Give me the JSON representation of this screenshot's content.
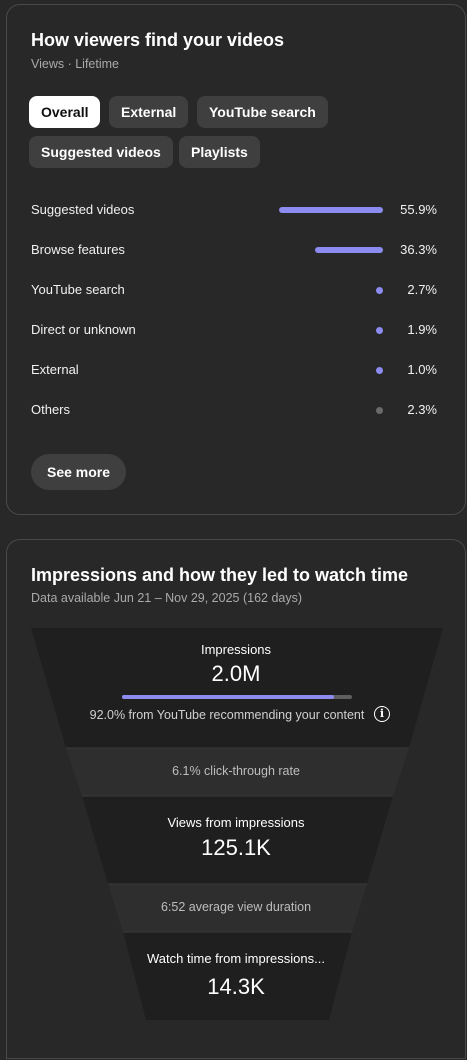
{
  "traffic_sources": {
    "title": "How viewers find your videos",
    "subtitle": "Views · Lifetime",
    "chips": [
      {
        "label": "Overall",
        "active": true
      },
      {
        "label": "External",
        "active": false
      },
      {
        "label": "YouTube search",
        "active": false
      },
      {
        "label": "Suggested videos",
        "active": false
      },
      {
        "label": "Playlists",
        "active": false
      }
    ],
    "rows": [
      {
        "label": "Suggested videos",
        "percent": "55.9%",
        "value": 55.9,
        "color": "#8c8cf0"
      },
      {
        "label": "Browse features",
        "percent": "36.3%",
        "value": 36.3,
        "color": "#8c8cf0"
      },
      {
        "label": "YouTube search",
        "percent": "2.7%",
        "value": 2.7,
        "color": "#8c8cf0"
      },
      {
        "label": "Direct or unknown",
        "percent": "1.9%",
        "value": 1.9,
        "color": "#8c8cf0"
      },
      {
        "label": "External",
        "percent": "1.0%",
        "value": 1.0,
        "color": "#8c8cf0"
      },
      {
        "label": "Others",
        "percent": "2.3%",
        "value": 2.3,
        "color": "#6a6a6a"
      }
    ],
    "see_more_label": "See more"
  },
  "impressions": {
    "title": "Impressions and how they led to watch time",
    "subtitle": "Data available Jun 21 – Nov 29, 2025 (162 days)",
    "impressions_label": "Impressions",
    "impressions_value": "2.0M",
    "recommended_fraction": 0.92,
    "recommended_text": "92.0% from YouTube recommending your content",
    "info_icon": "info-icon",
    "ctr_text": "6.1% click-through rate",
    "views_label": "Views from impressions",
    "views_value": "125.1K",
    "avd_text": "6:52 average view duration",
    "watch_label": "Watch time from impressions...",
    "watch_value": "14.3K"
  },
  "colors": {
    "accent": "#8c8cf0",
    "others_dot": "#6a6a6a",
    "card_bg": "#282828",
    "funnel_dark": "#1f1f1f",
    "funnel_light": "#2e2e2e"
  }
}
